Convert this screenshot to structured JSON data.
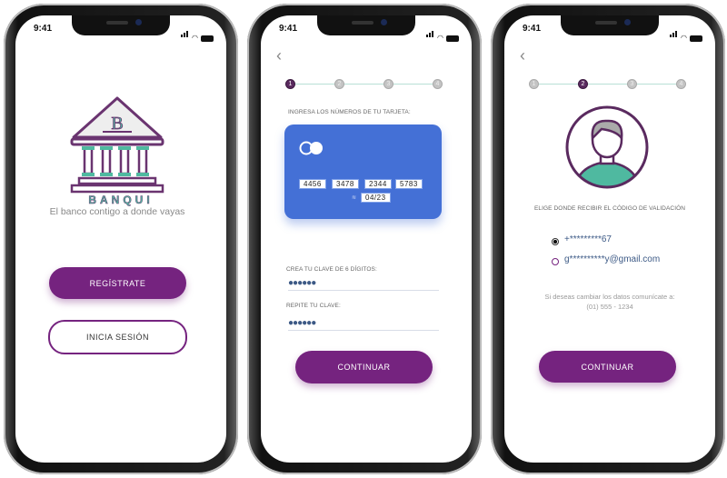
{
  "status_bar": {
    "time": "9:41"
  },
  "screen1": {
    "logo_letter": "B",
    "brand": "BANQUI",
    "tagline": "El banco contigo a donde vayas",
    "register_label": "REGÍSTRATE",
    "login_label": "INICIA SESIÓN"
  },
  "screen2": {
    "steps": [
      "1",
      "2",
      "3",
      "4"
    ],
    "active_step": 1,
    "card_prompt": "INGRESA LOS NÚMEROS DE TU TARJETA:",
    "card_numbers": [
      "4456",
      "3478",
      "2344",
      "5783"
    ],
    "expiry": "04/23",
    "card_color": "#4470d6",
    "pin_label": "CREA TU CLAVE DE 6 DÍGITOS:",
    "pin_value": "●●●●●●",
    "repeat_label": "REPITE TU CLAVE:",
    "repeat_value": "●●●●●●",
    "continue_label": "CONTINUAR"
  },
  "screen3": {
    "steps": [
      "1",
      "2",
      "3",
      "4"
    ],
    "active_step": 2,
    "prompt": "ELIGE DONDE RECIBIR EL CÓDIGO DE VALIDACIÓN",
    "options": [
      {
        "label": "+*********67",
        "selected": true
      },
      {
        "label": "g**********y@gmail.com",
        "selected": false
      }
    ],
    "change_text": "Si deseas cambiar los datos comunícate a:",
    "phone": "(01) 555 - 1234",
    "continue_label": "CONTINUAR"
  },
  "colors": {
    "primary": "#75237f",
    "accent": "#4fb9a0"
  }
}
